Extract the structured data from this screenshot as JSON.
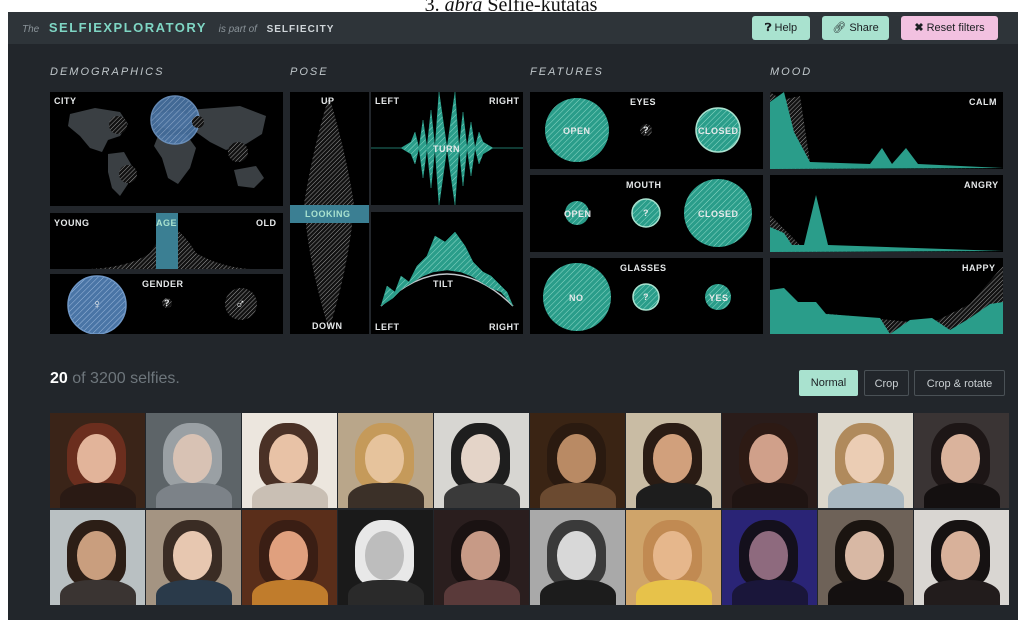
{
  "caption": {
    "number": "3.",
    "italic": "abra",
    "text": "Selfie-kutatás"
  },
  "header": {
    "prefix": "The",
    "title": "SELFIEXPLORATORY",
    "middle": "is part of",
    "suffix": "SELFIECITY",
    "buttons": {
      "help": "Help",
      "share": "Share",
      "reset": "Reset filters"
    }
  },
  "sections": {
    "demographics": "DEMOGRAPHICS",
    "pose": "POSE",
    "features": "FEATURES",
    "mood": "MOOD"
  },
  "demographics": {
    "city": "CITY",
    "age": {
      "label": "AGE",
      "young": "YOUNG",
      "old": "OLD"
    },
    "gender": {
      "label": "GENDER",
      "unknown": "?",
      "female_icon": "female-symbol-icon",
      "male_icon": "male-symbol-icon"
    }
  },
  "pose": {
    "up": "UP",
    "down": "DOWN",
    "looking": "LOOKING",
    "turn": {
      "label": "TURN",
      "left": "LEFT",
      "right": "RIGHT"
    },
    "tilt": {
      "label": "TILT",
      "left": "LEFT",
      "right": "RIGHT"
    }
  },
  "features": {
    "eyes": {
      "label": "EYES",
      "open": "OPEN",
      "unknown": "?",
      "closed": "CLOSED"
    },
    "mouth": {
      "label": "MOUTH",
      "open": "OPEN",
      "unknown": "?",
      "closed": "CLOSED"
    },
    "glasses": {
      "label": "GLASSES",
      "no": "NO",
      "unknown": "?",
      "yes": "YES"
    }
  },
  "mood": {
    "calm": "CALM",
    "angry": "ANGRY",
    "happy": "HAPPY"
  },
  "results": {
    "shown": "20",
    "rest": "of 3200 selfies."
  },
  "view_modes": {
    "normal": "Normal",
    "crop": "Crop",
    "crop_rotate": "Crop & rotate",
    "selected": "Normal"
  },
  "colors": {
    "accent": "#a9e2cf",
    "teal": "#2a9d8a",
    "selection_blue": "#5b86b8",
    "reset_pink": "#f2c1e0",
    "panel_bg": "#000000",
    "app_bg": "#22262b"
  },
  "photos": [
    {
      "bg": "#3a2418",
      "skin": "#e2b49a",
      "hair": "#6b2e1e",
      "cloth": "#2a1a14"
    },
    {
      "bg": "#5d6468",
      "skin": "#d8c2b4",
      "hair": "#9aa0a4",
      "cloth": "#7c8288"
    },
    {
      "bg": "#ece6de",
      "skin": "#e8c2a6",
      "hair": "#4a3126",
      "cloth": "#c9bfb4"
    },
    {
      "bg": "#b9a68a",
      "skin": "#e6c39c",
      "hair": "#c59a5a",
      "cloth": "#3b3028"
    },
    {
      "bg": "#d7d6d2",
      "skin": "#e4d4c8",
      "hair": "#1e1e1e",
      "cloth": "#3a3a3a"
    },
    {
      "bg": "#3a2414",
      "skin": "#b98a64",
      "hair": "#2a1a10",
      "cloth": "#6b4a30"
    },
    {
      "bg": "#c9bca4",
      "skin": "#d1a07c",
      "hair": "#2a1c14",
      "cloth": "#1d1d1d"
    },
    {
      "bg": "#2a1c1a",
      "skin": "#d0a08a",
      "hair": "#2d1a14",
      "cloth": "#1f1412"
    },
    {
      "bg": "#dcd7cc",
      "skin": "#ebcdb4",
      "hair": "#b08a5c",
      "cloth": "#a9b7c0"
    },
    {
      "bg": "#3a3434",
      "skin": "#dab39c",
      "hair": "#1d1616",
      "cloth": "#141010"
    },
    {
      "bg": "#b9c0c2",
      "skin": "#c99e7e",
      "hair": "#2c1e16",
      "cloth": "#3a3432"
    },
    {
      "bg": "#a49482",
      "skin": "#e7c7b0",
      "hair": "#3a2c24",
      "cloth": "#2a3a4a"
    },
    {
      "bg": "#5a2e1a",
      "skin": "#e0a07e",
      "hair": "#3a1e14",
      "cloth": "#c07c2c"
    },
    {
      "bg": "#1a1a1a",
      "skin": "#bdbdbd",
      "hair": "#e8e8e8",
      "cloth": "#2a2a2a"
    },
    {
      "bg": "#2a1e1e",
      "skin": "#c79a86",
      "hair": "#1a1212",
      "cloth": "#5a3a3a"
    },
    {
      "bg": "#a9a9a9",
      "skin": "#d8d8d8",
      "hair": "#3a3a3a",
      "cloth": "#1c1c1c"
    },
    {
      "bg": "#cfa46a",
      "skin": "#e6b78c",
      "hair": "#c18a52",
      "cloth": "#e7c24a"
    },
    {
      "bg": "#2a2476",
      "skin": "#8e6a7e",
      "hair": "#14101c",
      "cloth": "#1a163a"
    },
    {
      "bg": "#6e6258",
      "skin": "#d8b8a4",
      "hair": "#1a1410",
      "cloth": "#141010"
    },
    {
      "bg": "#d9d6d2",
      "skin": "#d8b19a",
      "hair": "#161212",
      "cloth": "#221c1c"
    }
  ]
}
